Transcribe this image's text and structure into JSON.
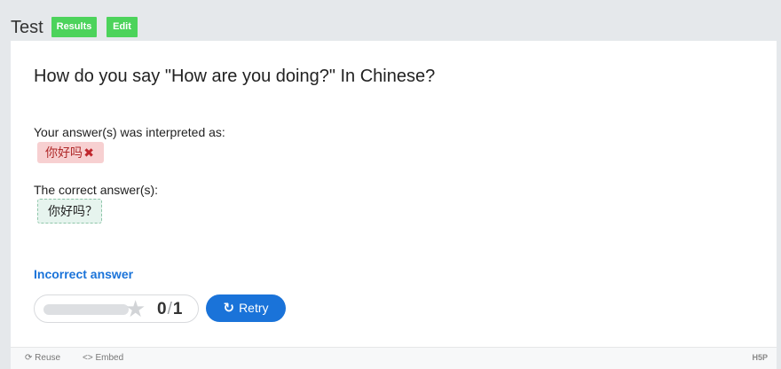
{
  "header": {
    "title": "Test",
    "results_label": "Results",
    "edit_label": "Edit"
  },
  "question": {
    "text": "How do you say \"How are you doing?\" In Chinese?",
    "interpreted_label": "Your answer(s) was interpreted as:",
    "user_answer": "你好吗",
    "correct_label": "The correct answer(s):",
    "correct_answer": "你好吗？"
  },
  "result": {
    "feedback": "Incorrect answer",
    "score": "0",
    "max_score": "1",
    "score_progress": 0,
    "retry_label": "Retry"
  },
  "footer": {
    "reuse_label": "Reuse",
    "embed_label": "Embed",
    "brand": "H5P"
  },
  "colors": {
    "accent": "#1a73d9",
    "success": "#4cd35b",
    "error_bg": "#f7d0d1",
    "correct_bg": "#e6f4ee"
  }
}
